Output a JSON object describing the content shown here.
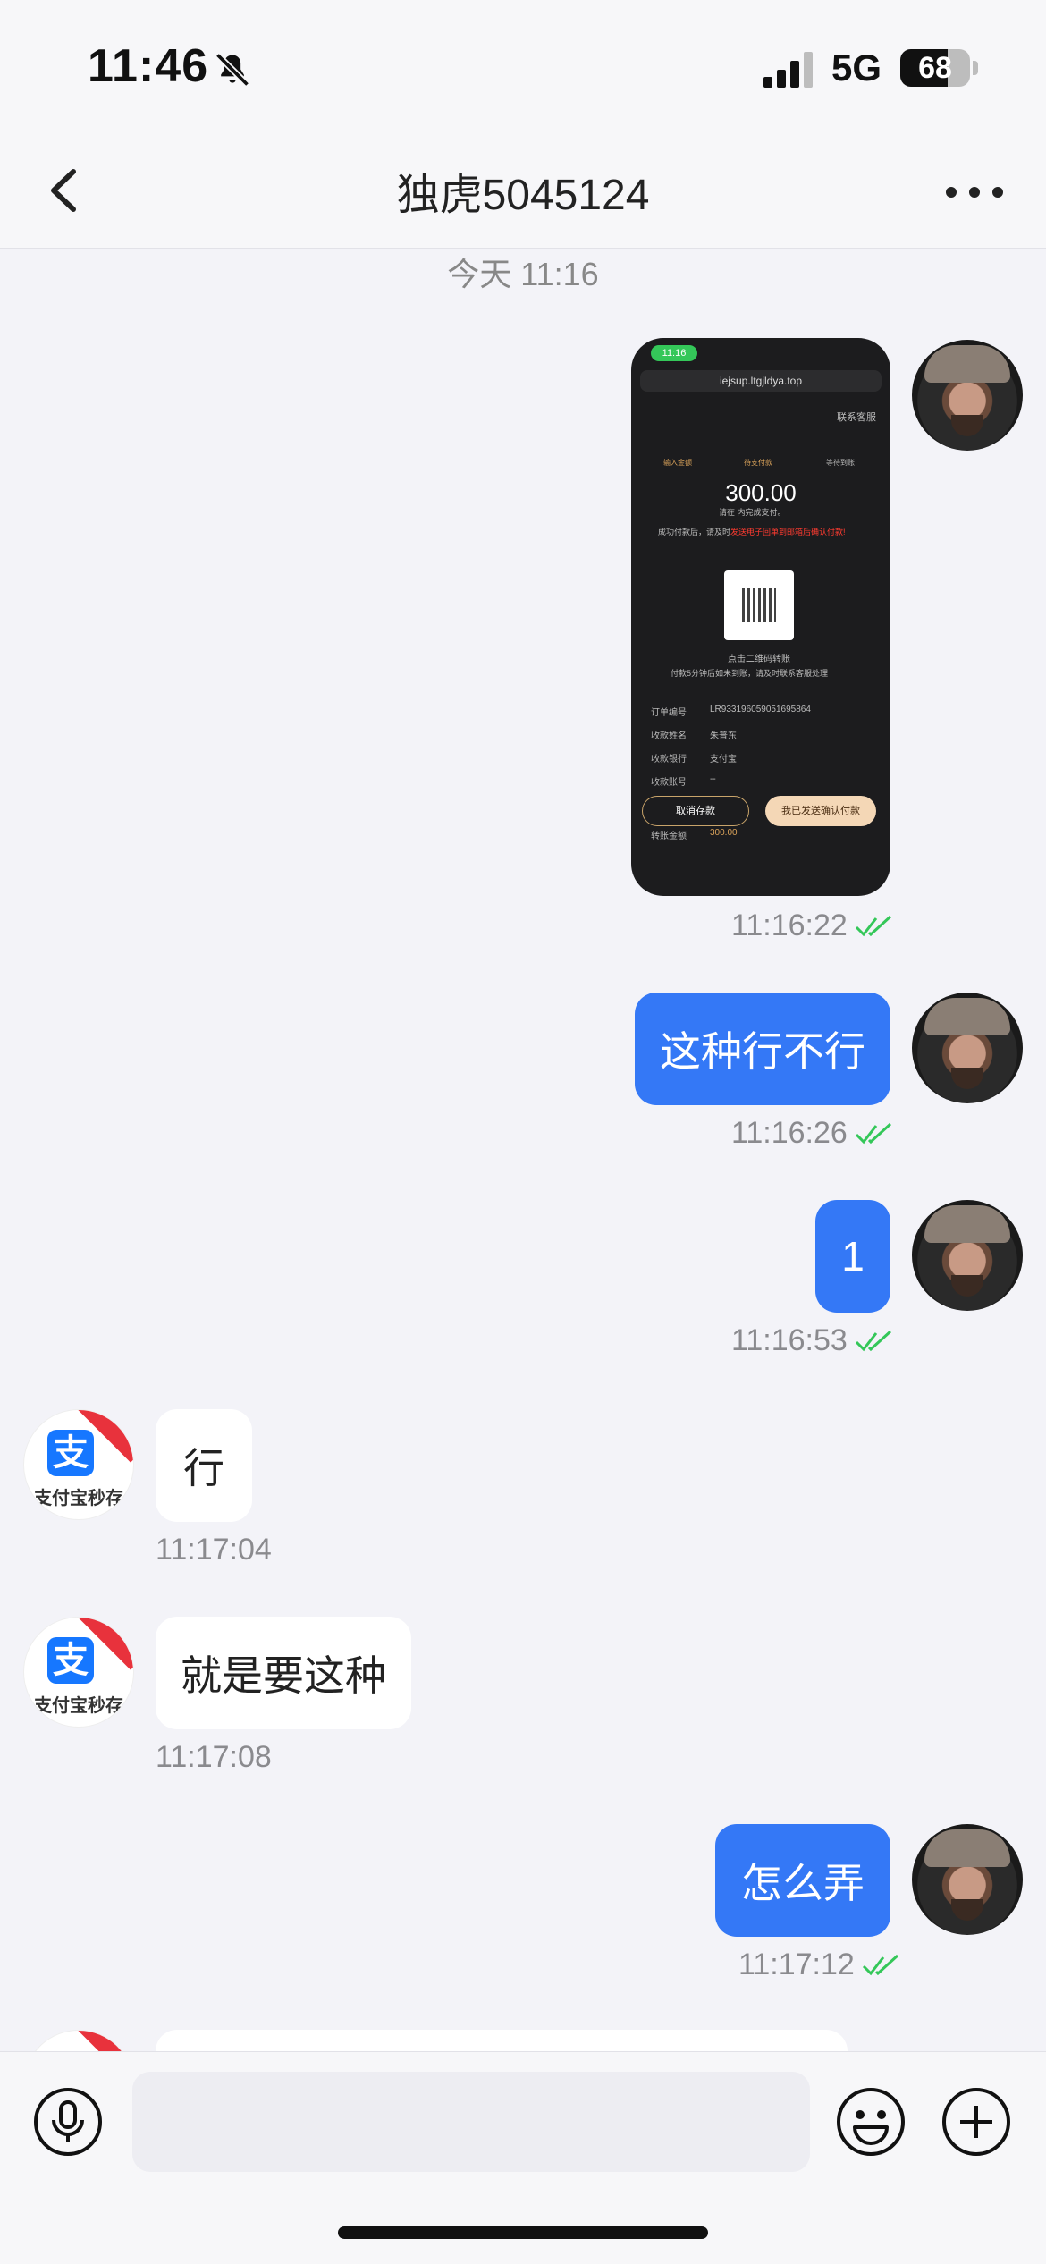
{
  "status_bar": {
    "time": "11:46",
    "network": "5G",
    "battery": "68",
    "battery_level": 0.68
  },
  "header": {
    "title": "独虎5045124"
  },
  "date_separator": "今天 11:16",
  "messages": [
    {
      "direction": "out",
      "type": "image",
      "time": "11:16:22",
      "read": true,
      "screenshot": {
        "status_time": "11:16",
        "url": "iejsup.ltgjldya.top",
        "header_right": "联系客服",
        "steps": [
          "输入金额",
          "待支付款",
          "等待到账"
        ],
        "amount": "300.00",
        "tip1": "请在 内完成支付。",
        "tip2": "成功付款后，请及时",
        "tip2_red": "发送电子回单到邮箱后确认付款!",
        "qr_caption": "点击二维码转账",
        "qr_caption2": "付款5分钟后如未到账，请及时联系客服处理",
        "rows": [
          {
            "label": "订单编号",
            "value": "LR933196059051695864"
          },
          {
            "label": "收款姓名",
            "value": "朱普东"
          },
          {
            "label": "收款银行",
            "value": "支付宝"
          },
          {
            "label": "收款账号",
            "value": "--"
          },
          {
            "label": "转账金额",
            "value": "300.00"
          }
        ],
        "cancel_btn": "取消存款",
        "confirm_btn": "我已发送确认付款"
      }
    },
    {
      "direction": "out",
      "type": "text",
      "text": "这种行不行",
      "time": "11:16:26",
      "read": true
    },
    {
      "direction": "out",
      "type": "text",
      "text": "1",
      "time": "11:16:53",
      "read": true
    },
    {
      "direction": "in",
      "type": "text",
      "text": "行",
      "time": "11:17:04"
    },
    {
      "direction": "in",
      "type": "text",
      "text": "就是要这种",
      "time": "11:17:08"
    },
    {
      "direction": "out",
      "type": "text",
      "text": "怎么弄",
      "time": "11:17:12",
      "read": true
    }
  ],
  "bot_avatar": {
    "logo_char": "支",
    "name": "支付宝秒存"
  },
  "input": {
    "placeholder": ""
  },
  "icons": {
    "back": "chevron-left-icon",
    "more": "ellipsis-icon",
    "mute": "bell-slash-icon",
    "mic": "microphone-icon",
    "emoji": "smiley-icon",
    "add": "plus-circle-icon",
    "read": "double-check-icon"
  },
  "colors": {
    "outgoing_bubble": "#3478f6",
    "incoming_bubble": "#ffffff",
    "read_check": "#34c759",
    "background": "#f3f3f8"
  }
}
